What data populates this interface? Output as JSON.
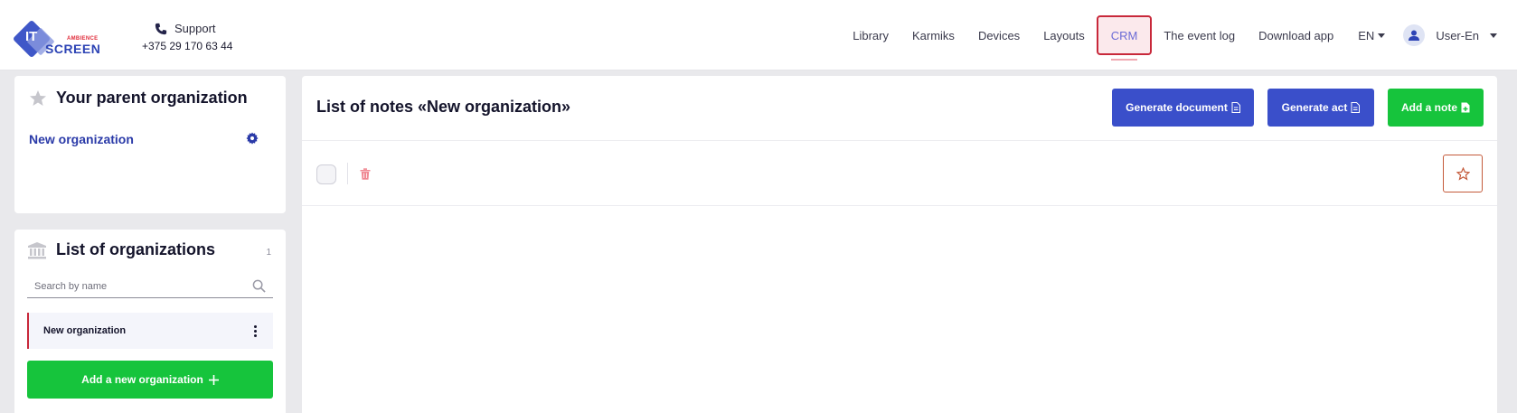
{
  "brand": {
    "top_text": "IT",
    "sub_text": "AMBIENCE",
    "name": "SCREEN"
  },
  "support": {
    "label": "Support",
    "phone": "+375 29 170 63 44",
    "icon": "phone-icon"
  },
  "nav": {
    "items": [
      {
        "label": "Library"
      },
      {
        "label": "Karmiks"
      },
      {
        "label": "Devices"
      },
      {
        "label": "Layouts"
      },
      {
        "label": "CRM",
        "active": true
      },
      {
        "label": "The event log"
      },
      {
        "label": "Download app"
      }
    ],
    "language": "EN",
    "user": "User-En"
  },
  "parent": {
    "title": "Your parent organization",
    "organization": "New organization",
    "icon": "star-icon"
  },
  "orgs": {
    "title": "List of organizations",
    "count": "1",
    "search_placeholder": "Search by name",
    "items": [
      {
        "label": "New organization"
      }
    ],
    "add_label": "Add a new organization",
    "icon": "bank-icon"
  },
  "notes": {
    "title": "List of notes «New organization»",
    "generate_document": "Generate document",
    "generate_act": "Generate act",
    "add_note": "Add a note"
  },
  "colors": {
    "accent_blue": "#3a4fca",
    "accent_green": "#16c43c",
    "active_red": "#c8283a"
  }
}
